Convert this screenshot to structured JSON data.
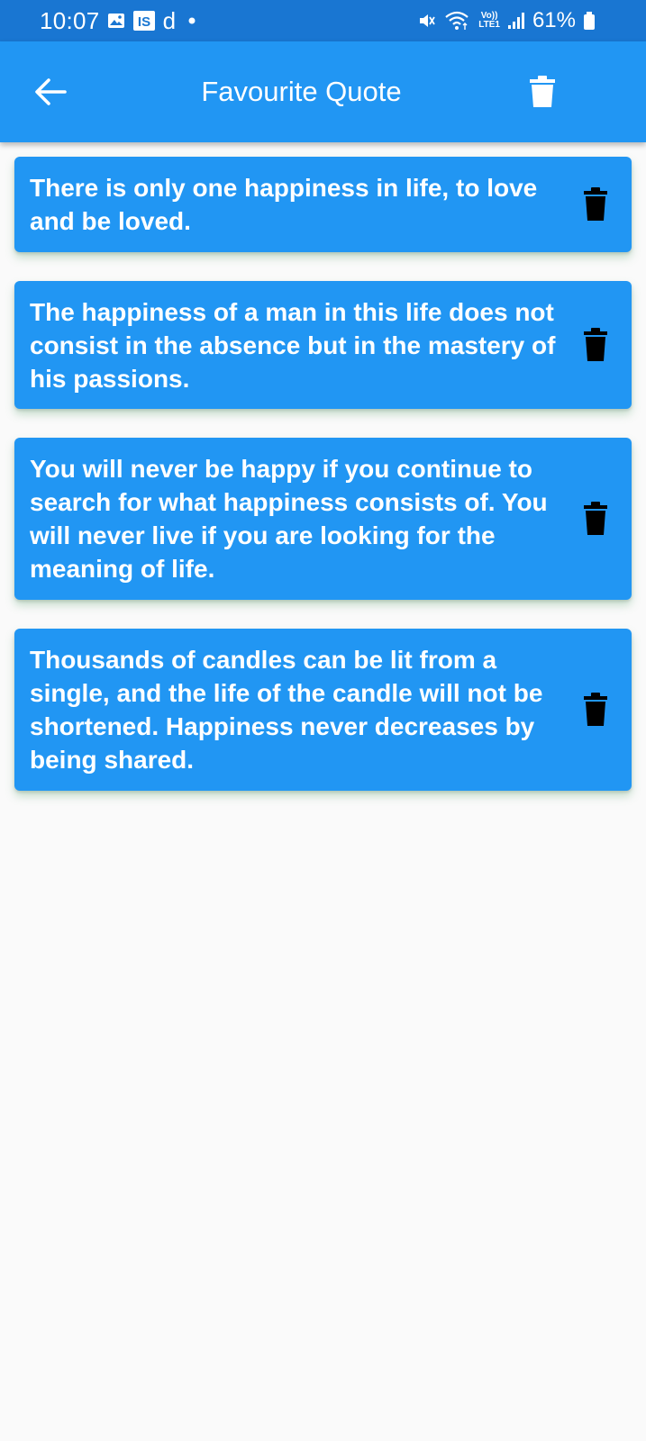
{
  "status_bar": {
    "time": "10:07",
    "notification_icons": [
      "image-icon",
      "is-app-icon",
      "d-app-icon",
      "dot-icon"
    ],
    "is_label": "IS",
    "d_label": "d",
    "system_icons": [
      "mute-icon",
      "wifi-icon",
      "volte-icon",
      "signal-icon",
      "battery-icon"
    ],
    "volte_label": "Vo))",
    "lte_label": "LTE1",
    "battery": "61%"
  },
  "app_bar": {
    "title": "Favourite Quote",
    "back_icon": "arrow-back-icon",
    "delete_all_icon": "trash-icon"
  },
  "colors": {
    "status_bar": "#1976d2",
    "app_bar": "#2196f3",
    "card": "#2196f3",
    "background": "#fafafa",
    "card_text": "#ffffff",
    "delete_icon": "#000000"
  },
  "quotes": [
    {
      "text": "There is only one happiness in life, to love and be loved."
    },
    {
      "text": "The happiness of a man in this life does not consist in the absence but in the mastery of his passions."
    },
    {
      "text": "You will never be happy if you continue to search for what happiness consists of. You will never live if you are looking for the meaning of life."
    },
    {
      "text": "Thousands of candles can be lit from a single, and the life of the candle will not be shortened. Happiness never decreases by being shared."
    }
  ]
}
